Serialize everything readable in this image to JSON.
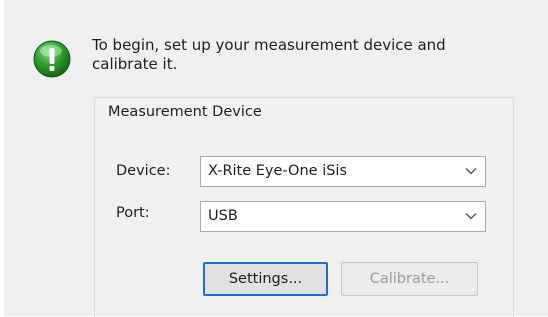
{
  "intro": {
    "icon": "green-info-icon",
    "text": "To begin, set up your measurement device and calibrate it."
  },
  "measurement_device": {
    "title": "Measurement Device",
    "device": {
      "label": "Device:",
      "value": "X-Rite Eye-One iSis"
    },
    "port": {
      "label": "Port:",
      "value": "USB"
    },
    "settings_button": "Settings...",
    "calibrate_button": "Calibrate...",
    "calibrate_enabled": false
  },
  "colors": {
    "info_icon": "#2e9a2e",
    "focus_border": "#1c6fd0",
    "panel_background": "#f0f0f0"
  }
}
